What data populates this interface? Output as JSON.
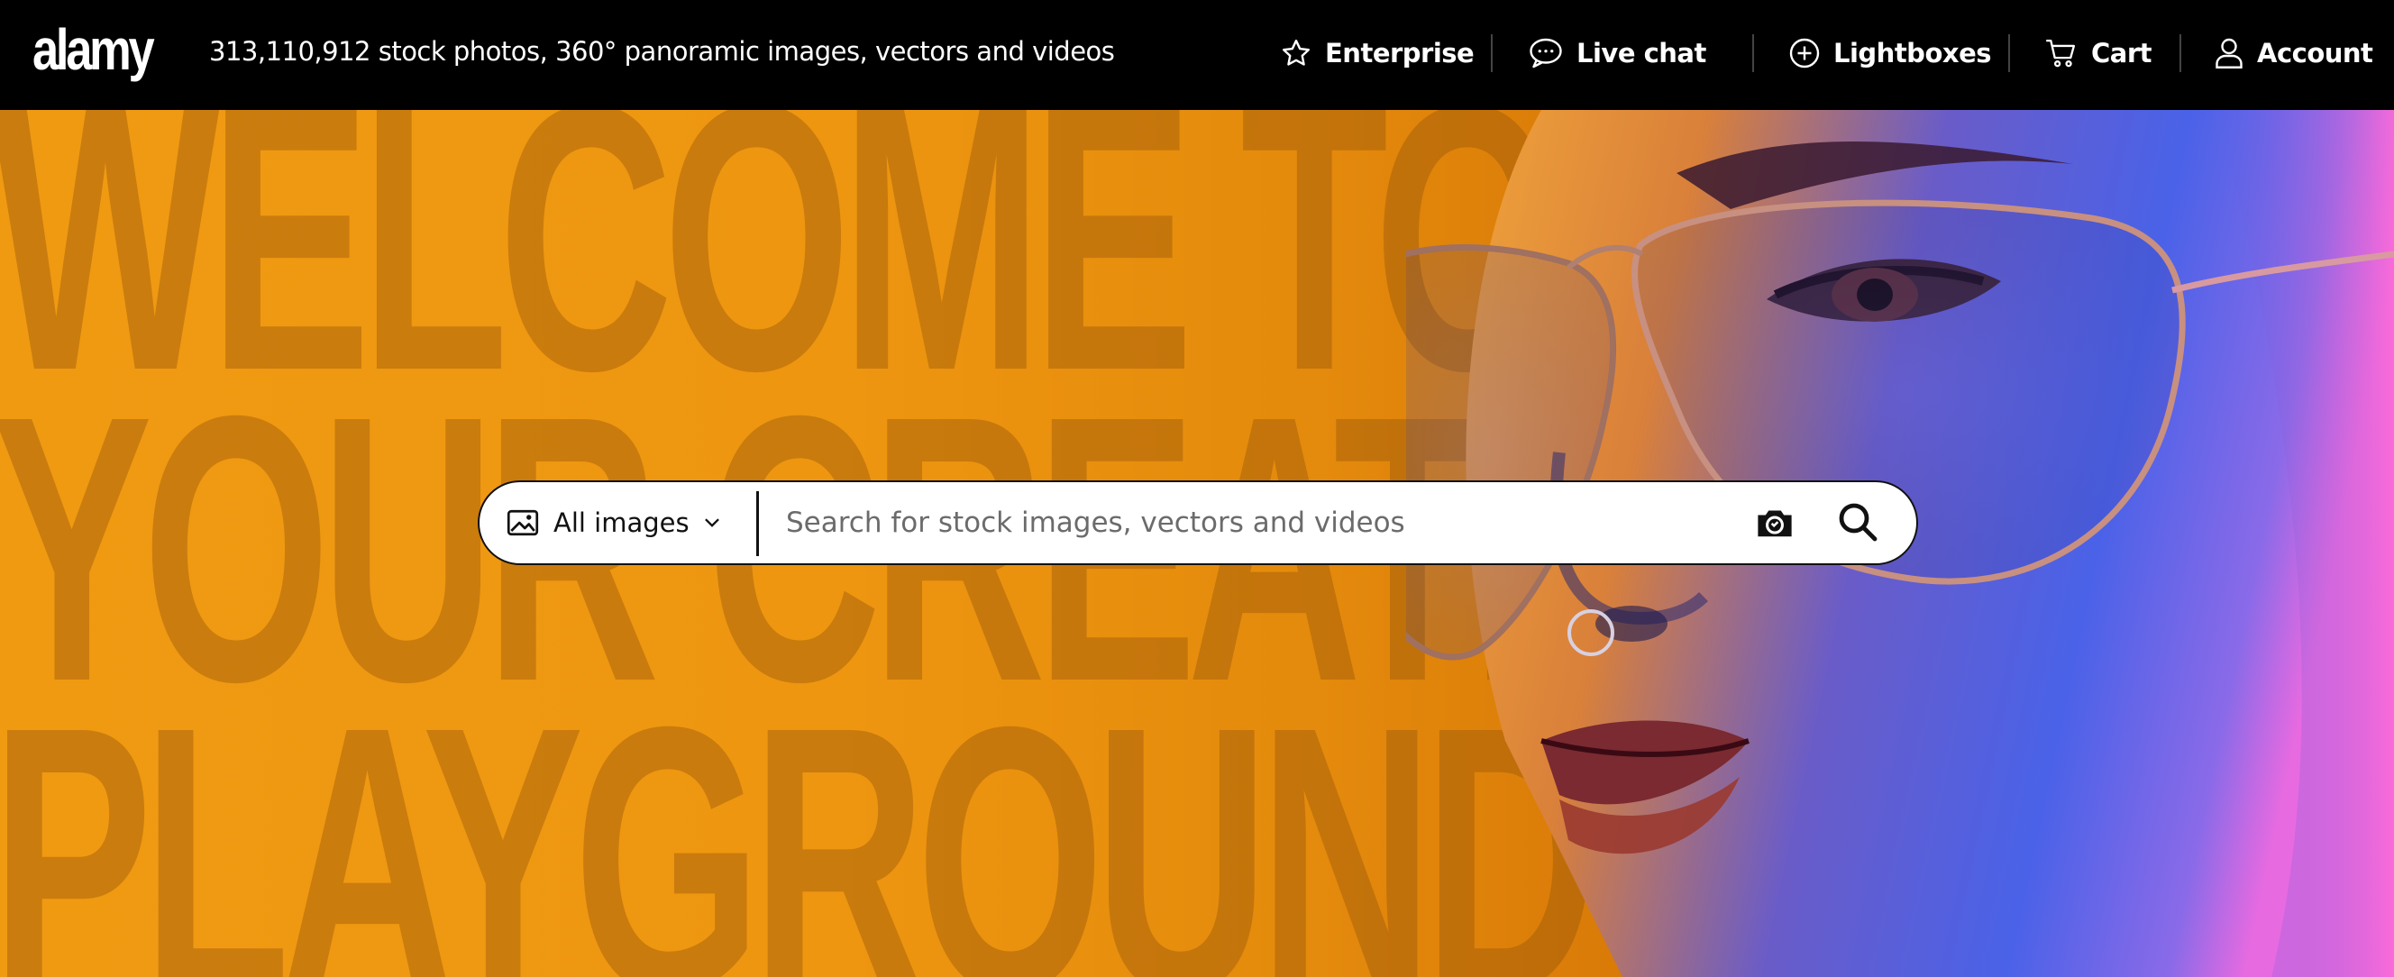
{
  "header": {
    "logo": "alamy",
    "tagline": "313,110,912 stock photos, 360° panoramic images, vectors and videos",
    "nav": {
      "enterprise": "Enterprise",
      "live_chat": "Live chat",
      "lightboxes": "Lightboxes",
      "cart": "Cart",
      "account": "Account"
    }
  },
  "hero": {
    "lines": [
      "WELCOME TO",
      "YOUR CREATIVE",
      "PLAYGROUND"
    ]
  },
  "search": {
    "type_label": "All images",
    "placeholder": "Search for stock images, vectors and videos",
    "value": ""
  },
  "colors": {
    "header_bg": "#000000",
    "hero_orange": "#f09a12",
    "search_bg": "#ffffff"
  },
  "icons": {
    "enterprise": "star-icon",
    "live_chat": "chat-bubble-icon",
    "lightboxes": "plus-circle-icon",
    "cart": "cart-icon",
    "account": "user-icon",
    "search_type": "image-icon",
    "dropdown": "chevron-down-icon",
    "visual_search": "camera-icon",
    "search": "search-icon"
  }
}
